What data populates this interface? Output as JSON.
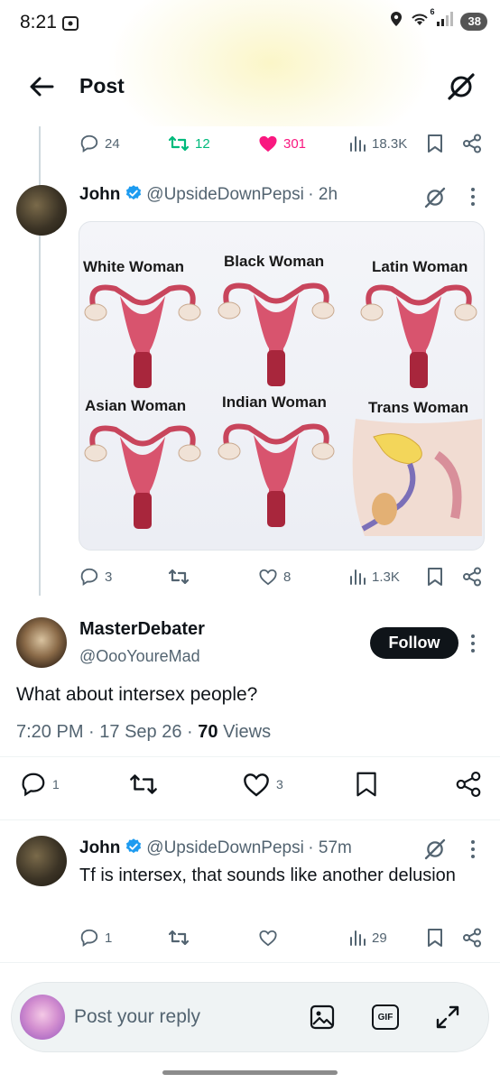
{
  "status_bar": {
    "time": "8:21",
    "network": "6",
    "battery": "38"
  },
  "header": {
    "title": "Post",
    "back_icon": "arrow-left-icon",
    "grok_icon": "grok-icon"
  },
  "parent_actions": {
    "replies": "24",
    "reposts": "12",
    "likes": "301",
    "views": "18.3K",
    "like_color": "#f91880",
    "repost_color": "#00ba7c"
  },
  "tweet_john_1": {
    "name": "John",
    "handle": "@UpsideDownPepsi",
    "time": "· 2h",
    "image_labels": [
      "White Woman",
      "Black Woman",
      "Latin Woman",
      "Asian Woman",
      "Indian Woman",
      "Trans Woman"
    ],
    "replies": "3",
    "reposts": "",
    "likes": "8",
    "views": "1.3K"
  },
  "main_tweet": {
    "name": "MasterDebater",
    "handle": "@OooYoureMad",
    "follow_label": "Follow",
    "text": "What about intersex people?",
    "time": "7:20 PM",
    "date": "17 Sep 26",
    "views_count": "70",
    "views_label": "Views",
    "replies": "1",
    "likes": "3"
  },
  "tweet_john_2": {
    "name": "John",
    "handle": "@UpsideDownPepsi",
    "time": "· 57m",
    "text": "Tf is intersex, that sounds like another delusion",
    "replies": "1",
    "views": "29"
  },
  "reply_bar": {
    "placeholder": "Post your reply",
    "gif_label": "GIF"
  },
  "colors": {
    "verified": "#1d9bf0",
    "text": "#0f1419",
    "muted": "#536471"
  }
}
